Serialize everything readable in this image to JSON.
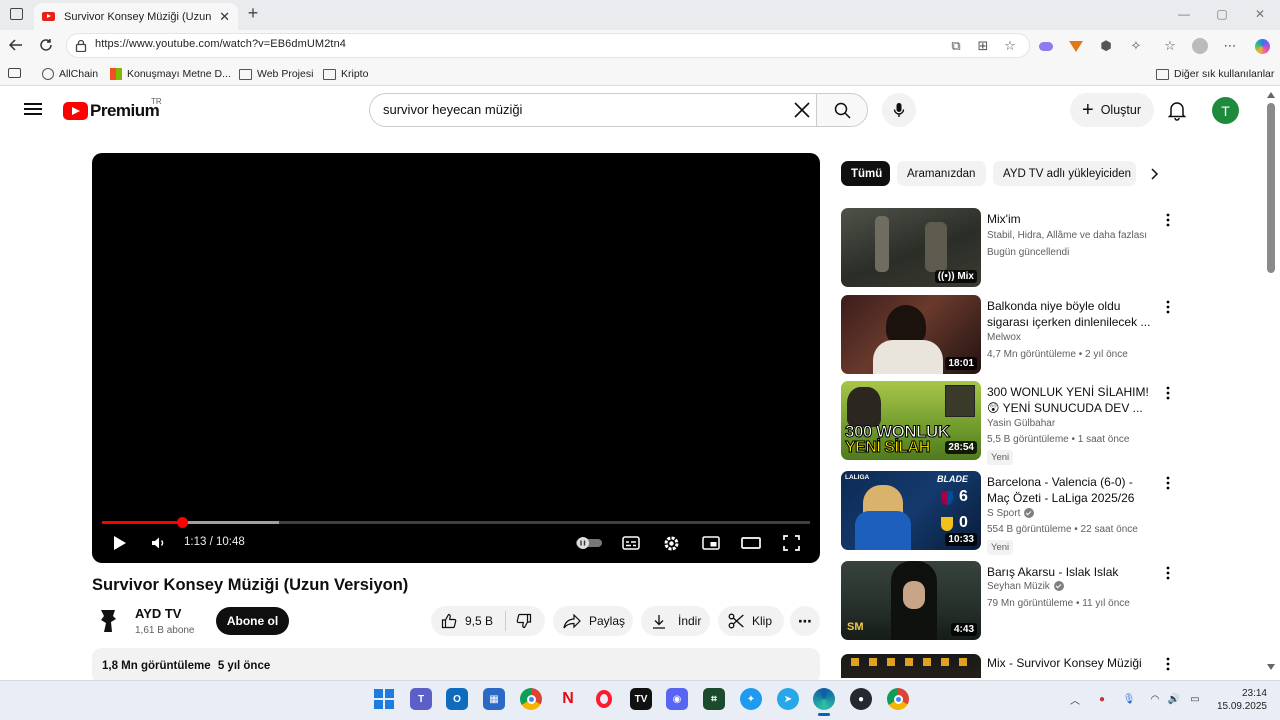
{
  "browser": {
    "tab_title": "Survivor Konsey Müziği (Uzun Ver",
    "url": "https://www.youtube.com/watch?v=EB6dmUM2tn4",
    "bookmarks": [
      "AllChain",
      "Konuşmayı Metne D...",
      "Web Projesi",
      "Kripto"
    ],
    "other_bookmarks": "Diğer sık kullanılanlar"
  },
  "header": {
    "logo_text": "Premium",
    "region": "TR",
    "search_query": "survivor heyecan müziği",
    "create_label": "Oluştur",
    "avatar_letter": "T"
  },
  "player": {
    "current_time": "1:13",
    "duration": "10:48",
    "time_display": "1:13 / 10:48",
    "progress_fraction": 0.113,
    "buffered_fraction": 0.25
  },
  "video": {
    "title": "Survivor Konsey Müziği (Uzun Versiyon)",
    "channel": "AYD TV",
    "subscribers": "1,61 B abone",
    "subscribe_label": "Abone ol",
    "likes": "9,5 B",
    "share_label": "Paylaş",
    "download_label": "İndir",
    "clip_label": "Klip",
    "views": "1,8 Mn görüntüleme",
    "age": "5 yıl önce"
  },
  "chips": [
    "Tümü",
    "Aramanızdan",
    "AYD TV adlı yükleyiciden"
  ],
  "recommendations": [
    {
      "title": "Mix'im",
      "channel": "Stabil, Hidra, Allâme ve daha fazlası",
      "meta": "Bugün güncellendi",
      "badge": "",
      "duration": "Mix",
      "verified": false
    },
    {
      "title": "Balkonda niye böyle oldu sigarası içerken dinlenilecek ...",
      "channel": "Melwox",
      "meta": "4,7 Mn görüntüleme • 2 yıl önce",
      "badge": "",
      "duration": "18:01",
      "verified": false
    },
    {
      "title": "300 WONLUK YENİ SİLAHIM! 😲 YENİ SUNUCUDA DEV ...",
      "channel": "Yasin Gülbahar",
      "meta": "5,5 B görüntüleme • 1 saat önce",
      "badge": "Yeni",
      "duration": "28:54",
      "verified": false,
      "thumb_text": [
        "300 WONLUK",
        "YENİ SİLAH"
      ]
    },
    {
      "title": "Barcelona - Valencia (6-0) - Maç Özeti - LaLiga 2025/26",
      "channel": "S Sport",
      "meta": "554 B görüntüleme • 22 saat önce",
      "badge": "Yeni",
      "duration": "10:33",
      "verified": true,
      "thumb_text": [
        "BLADE",
        "6",
        "0",
        "LALIGA"
      ]
    },
    {
      "title": "Barış Akarsu - Islak Islak",
      "channel": "Seyhan Müzik",
      "meta": "79 Mn görüntüleme • 11 yıl önce",
      "badge": "",
      "duration": "4:43",
      "verified": true,
      "thumb_text": [
        "SM"
      ]
    },
    {
      "title": "Mix - Survivor Konsey Müziği",
      "channel": "",
      "meta": "",
      "badge": "",
      "duration": "",
      "verified": false
    }
  ],
  "taskbar": {
    "time": "23:14",
    "date": "15.09.2025"
  },
  "colors": {
    "youtube_red": "#ff0000",
    "avatar_green": "#1e8a3b",
    "text_primary": "#0f0f0f",
    "text_secondary": "#606060"
  }
}
